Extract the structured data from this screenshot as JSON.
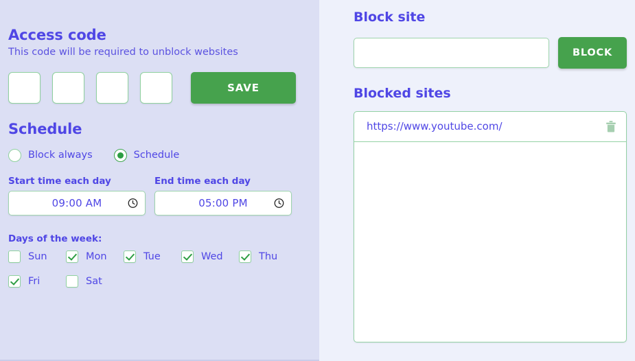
{
  "colors": {
    "heading": "#4f46e5",
    "accent_green": "#46a24d",
    "left_bg": "#dcdff4",
    "right_bg": "#eef1fb",
    "input_border": "#93d1a4"
  },
  "left": {
    "access_code": {
      "title": "Access code",
      "subtitle": "This code will be required to unblock websites",
      "digits": [
        "",
        "",
        "",
        ""
      ],
      "save_label": "SAVE"
    },
    "schedule": {
      "title": "Schedule",
      "modes": [
        {
          "label": "Block always",
          "selected": false
        },
        {
          "label": "Schedule",
          "selected": true
        }
      ],
      "start_label": "Start time each day",
      "start_value": "09:00 AM",
      "end_label": "End time each day",
      "end_value": "05:00 PM",
      "clock_icon": "clock-icon",
      "days_label": "Days of the week:",
      "days": [
        {
          "label": "Sun",
          "checked": false
        },
        {
          "label": "Mon",
          "checked": true
        },
        {
          "label": "Tue",
          "checked": true
        },
        {
          "label": "Wed",
          "checked": true
        },
        {
          "label": "Thu",
          "checked": true
        },
        {
          "label": "Fri",
          "checked": true
        },
        {
          "label": "Sat",
          "checked": false
        }
      ]
    }
  },
  "right": {
    "block_site": {
      "title": "Block site",
      "input_value": "",
      "input_placeholder": "",
      "button_label": "BLOCK"
    },
    "blocked_sites": {
      "title": "Blocked sites",
      "items": [
        {
          "url": "https://www.youtube.com/",
          "delete_icon": "trash-icon"
        }
      ]
    }
  }
}
